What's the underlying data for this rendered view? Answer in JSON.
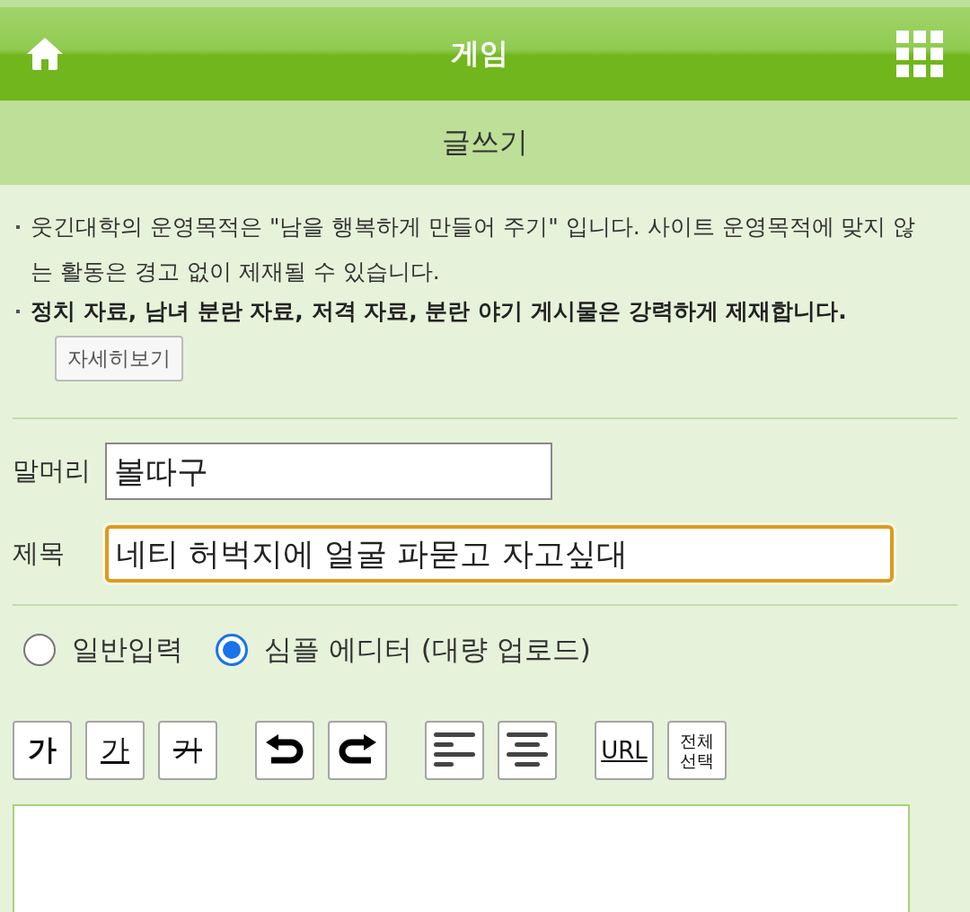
{
  "header": {
    "title": "게임"
  },
  "subheader": {
    "title": "글쓰기"
  },
  "notices": [
    {
      "text": "웃긴대학의 운영목적은 \"남을 행복하게 만들어 주기\" 입니다. 사이트 운영목적에 맞지 않는 활동은 경고 없이 제재될 수 있습니다.",
      "bold": false
    },
    {
      "text": "정치 자료, 남녀 분란 자료, 저격 자료, 분란 야기 게시물은 강력하게 제재합니다.",
      "bold": true
    }
  ],
  "details_button": "자세히보기",
  "fields": [
    {
      "label": "말머리",
      "value": "볼따구",
      "focused": false
    },
    {
      "label": "제목",
      "value": "네티 허벅지에 얼굴 파묻고 자고싶대",
      "focused": true
    }
  ],
  "modes": [
    {
      "label": "일반입력",
      "selected": false
    },
    {
      "label": "심플 에디터 (대량 업로드)",
      "selected": true
    }
  ],
  "toolbar": [
    [
      {
        "kind": "bold",
        "label": "가"
      },
      {
        "kind": "underline",
        "label": "가"
      },
      {
        "kind": "strike",
        "label": "가"
      }
    ],
    [
      {
        "kind": "undo"
      },
      {
        "kind": "redo"
      }
    ],
    [
      {
        "kind": "align-left"
      },
      {
        "kind": "align-center"
      }
    ],
    [
      {
        "kind": "link",
        "label": "URL"
      },
      {
        "kind": "select-all",
        "label": "전체 선택"
      }
    ]
  ]
}
